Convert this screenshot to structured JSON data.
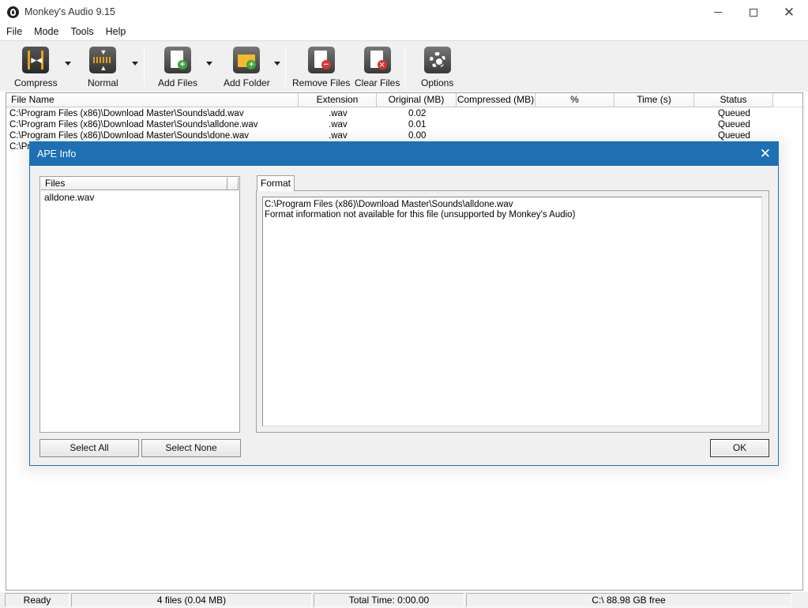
{
  "window": {
    "title": "Monkey's Audio 9.15"
  },
  "menu": [
    "File",
    "Mode",
    "Tools",
    "Help"
  ],
  "toolbar": {
    "compress": "Compress",
    "normal": "Normal",
    "add_files": "Add Files",
    "add_folder": "Add Folder",
    "remove_files": "Remove Files",
    "clear_files": "Clear Files",
    "options": "Options"
  },
  "table": {
    "columns": [
      "File Name",
      "Extension",
      "Original (MB)",
      "Compressed (MB)",
      "%",
      "Time (s)",
      "Status"
    ],
    "rows": [
      {
        "name": "C:\\Program Files (x86)\\Download Master\\Sounds\\add.wav",
        "ext": ".wav",
        "orig": "0.02",
        "status": "Queued"
      },
      {
        "name": "C:\\Program Files (x86)\\Download Master\\Sounds\\alldone.wav",
        "ext": ".wav",
        "orig": "0.01",
        "status": "Queued"
      },
      {
        "name": "C:\\Program Files (x86)\\Download Master\\Sounds\\done.wav",
        "ext": ".wav",
        "orig": "0.00",
        "status": "Queued"
      },
      {
        "name": "C:\\Pr",
        "ext": "",
        "orig": "",
        "status": ""
      }
    ]
  },
  "statusbar": {
    "state": "Ready",
    "files": "4 files (0.04 MB)",
    "total_time": "Total Time: 0:00.00",
    "free": "C:\\ 88.98 GB free"
  },
  "dialog": {
    "title": "APE Info",
    "files_header": "Files",
    "files": [
      "alldone.wav"
    ],
    "tab": "Format",
    "format_lines": [
      "C:\\Program Files (x86)\\Download Master\\Sounds\\alldone.wav",
      "Format information not available for this file (unsupported by Monkey's Audio)"
    ],
    "select_all": "Select All",
    "select_none": "Select None",
    "ok": "OK"
  }
}
